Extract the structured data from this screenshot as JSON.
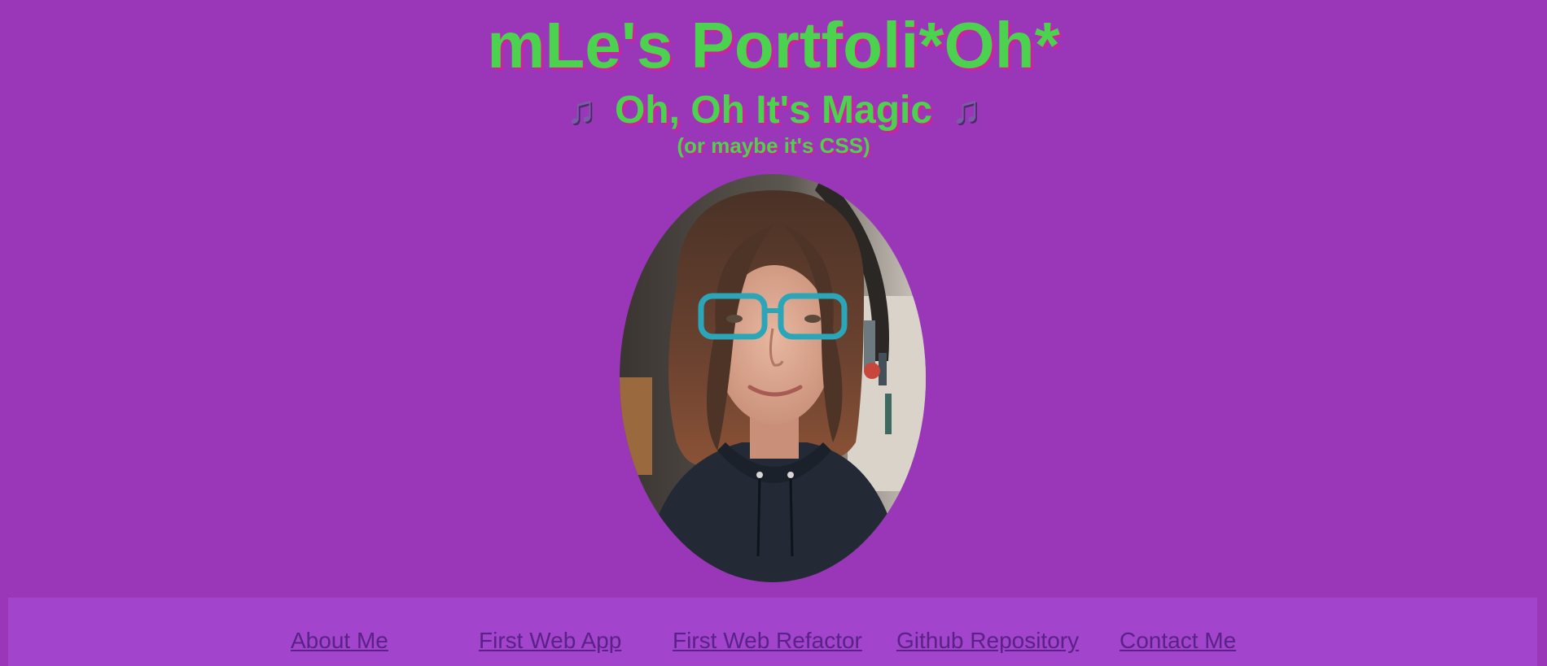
{
  "header": {
    "title": "mLe's Portfoli*Oh*",
    "subtitle": "Oh, Oh It's Magic",
    "subtitle_icon": "music-note-icon",
    "tagline": "(or maybe it's CSS)"
  },
  "colors": {
    "background": "#9a36b8",
    "heading_green": "#4bd24e",
    "heading_shadow": "#d21fa0",
    "navbar_background": "#a244cc",
    "link": "#5a2287"
  },
  "navigation": {
    "links": [
      {
        "label": "About Me"
      },
      {
        "label": "First Web App"
      },
      {
        "label": "First Web Refactor"
      },
      {
        "label": "Github Repository"
      },
      {
        "label": "Contact Me"
      }
    ]
  }
}
